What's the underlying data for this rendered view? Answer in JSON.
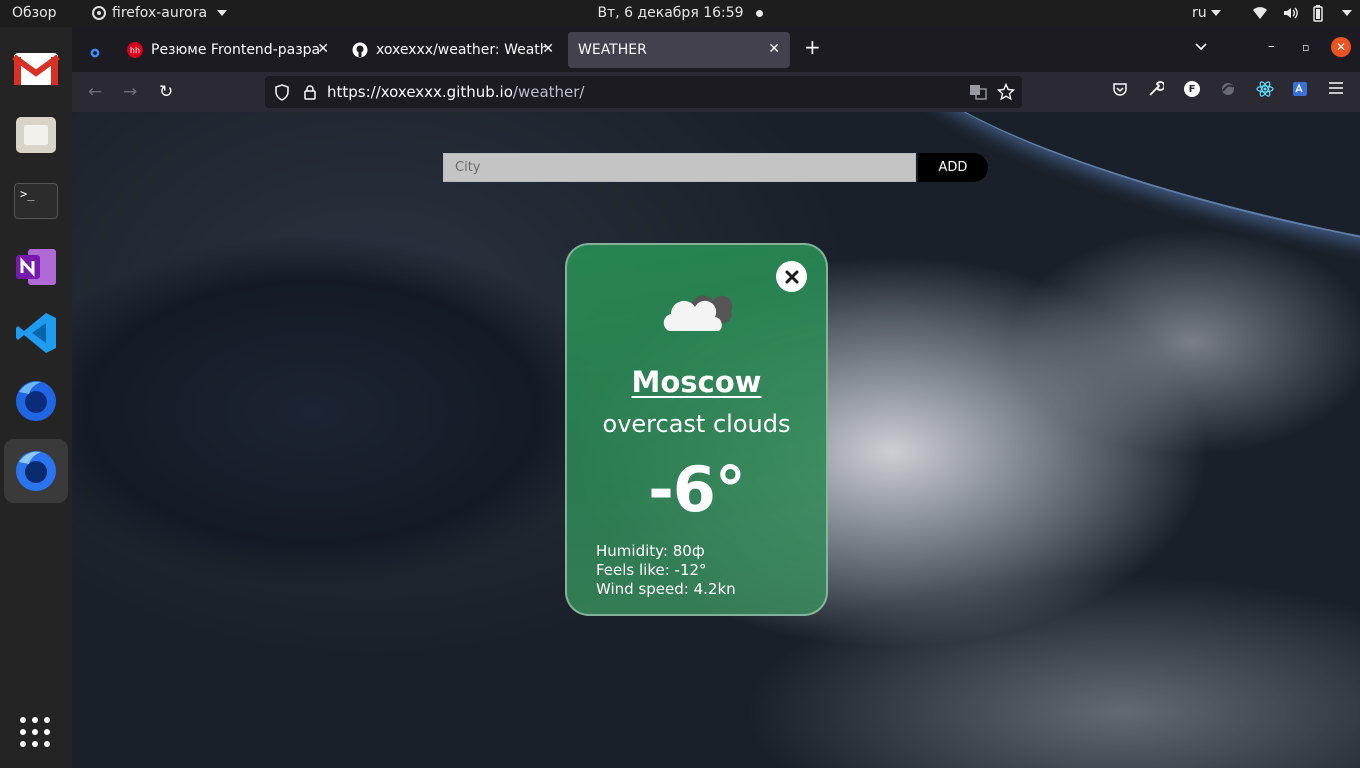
{
  "os_topbar": {
    "activities": "Обзор",
    "app_name": "firefox-aurora",
    "clock": "Вт, 6 декабря  16:59",
    "language": "ru"
  },
  "dock": {
    "apps": [
      "gmail-icon",
      "files-icon",
      "terminal-icon",
      "onenote-icon",
      "vscode-icon",
      "firefox-icon",
      "firefox-nightly-icon"
    ],
    "terminal_glyph": ">_"
  },
  "browser": {
    "tabs": [
      {
        "title": "Резюме Frontend-разработ",
        "favicon_text": "hh",
        "favicon_color": "#d6001c"
      },
      {
        "title": "xoxexxx/weather: Weathe",
        "favicon_color": "#ffffff"
      },
      {
        "title": "WEATHER"
      }
    ],
    "url_host": "https://xoxexxx.github.io",
    "url_path": "/weather/",
    "extension_f_label": "F"
  },
  "app": {
    "search": {
      "placeholder": "City",
      "button_label": "ADD"
    },
    "card": {
      "city": "Moscow",
      "description": "overcast clouds",
      "temperature": "-6°",
      "humidity": "Humidity: 80ф",
      "feels_like": "Feels like: -12°",
      "wind_speed": "Wind speed: 4.2kn",
      "background_color": "#2e8b57"
    }
  }
}
